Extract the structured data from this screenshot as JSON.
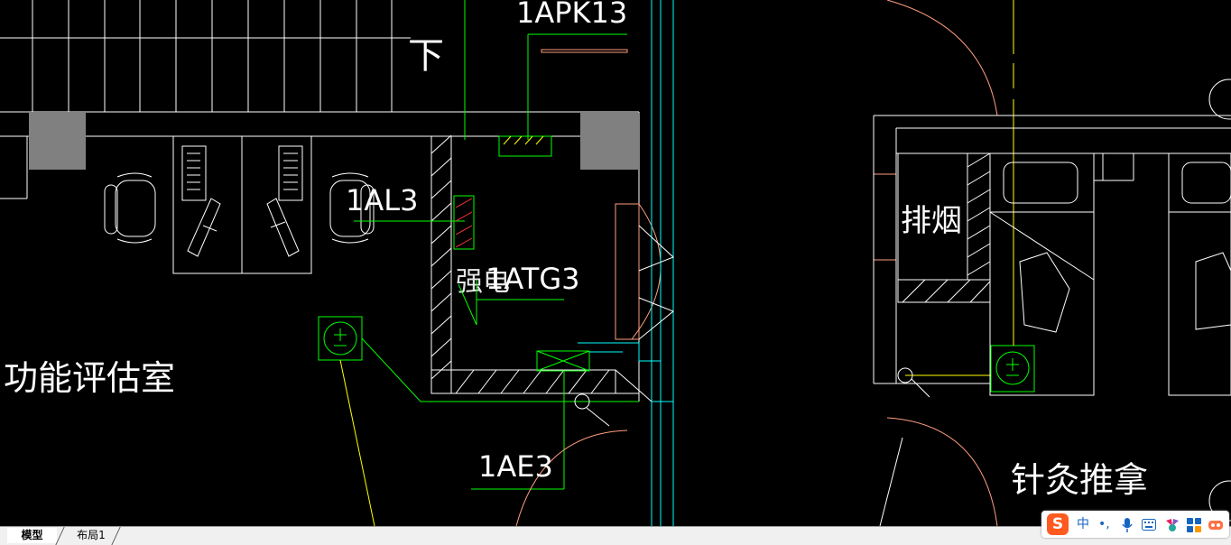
{
  "drawing": {
    "labels": {
      "apk": "1APK13",
      "al": "1AL3",
      "atg": "1ATG3",
      "ae": "1AE3",
      "strong_electric": "强电",
      "down": "下",
      "room_function": "功能评估室",
      "room_smoke": "排烟",
      "room_acupuncture": "针灸推拿"
    },
    "colors": {
      "background": "#000000",
      "wall": "#ffffff",
      "circuit": "#00ff00",
      "door": "#ff9e80",
      "yellow": "#ffff00",
      "cyan": "#00ffff",
      "column": "#808080"
    }
  },
  "tabs": {
    "model": "模型",
    "layout1": "布局1"
  },
  "ime": {
    "logo": "S",
    "mode": "中",
    "punct": "•,",
    "items": [
      "mic-icon",
      "keyboard-icon",
      "skin-icon",
      "grid-icon",
      "tools-icon"
    ]
  }
}
